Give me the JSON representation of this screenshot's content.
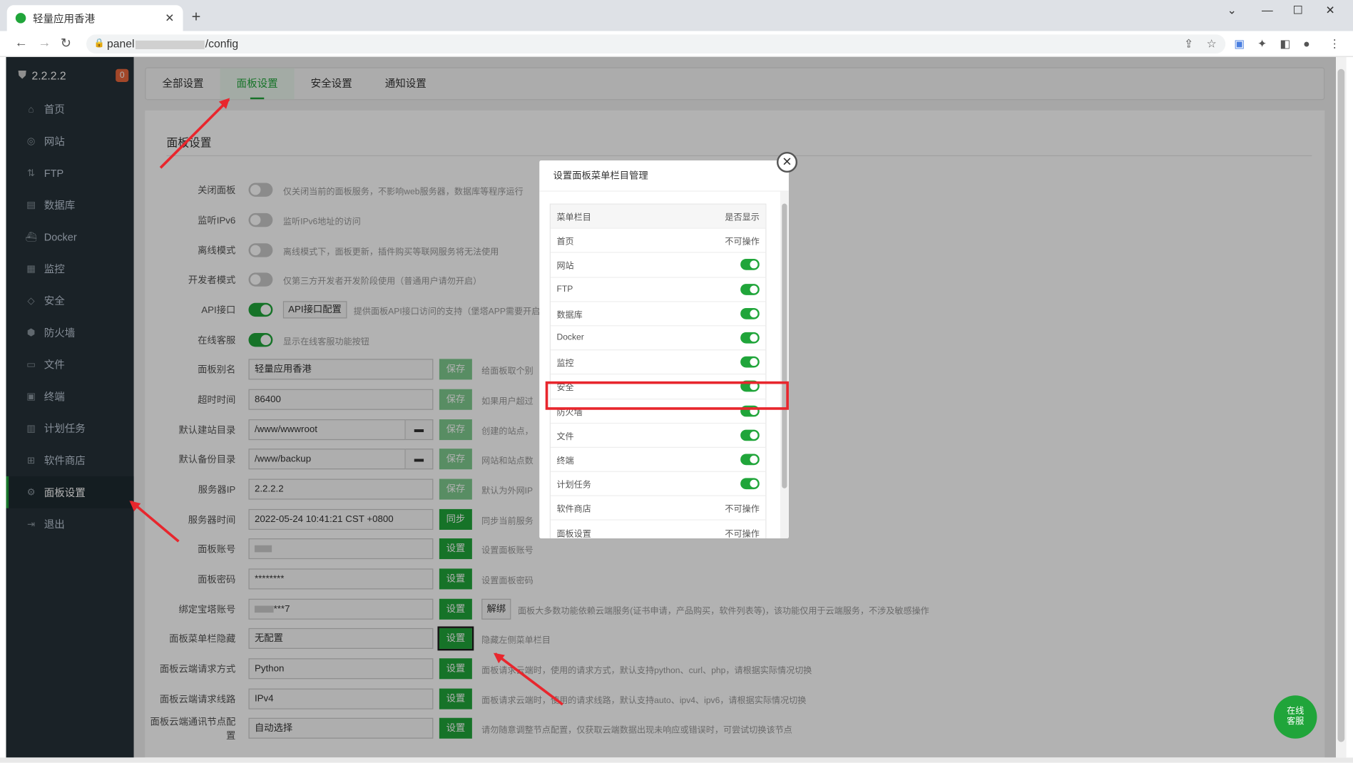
{
  "browser": {
    "tab_title": "轻量应用香港",
    "url_prefix": "panel",
    "url_suffix": "/config"
  },
  "sidebar": {
    "version": "2.2.2.2",
    "badge": "0",
    "items": [
      {
        "label": "首页",
        "icon": "home-icon"
      },
      {
        "label": "网站",
        "icon": "globe-icon"
      },
      {
        "label": "FTP",
        "icon": "ftp-icon"
      },
      {
        "label": "数据库",
        "icon": "database-icon"
      },
      {
        "label": "Docker",
        "icon": "docker-icon"
      },
      {
        "label": "监控",
        "icon": "monitor-icon"
      },
      {
        "label": "安全",
        "icon": "shield-icon"
      },
      {
        "label": "防火墙",
        "icon": "firewall-icon"
      },
      {
        "label": "文件",
        "icon": "folder-icon"
      },
      {
        "label": "终端",
        "icon": "terminal-icon"
      },
      {
        "label": "计划任务",
        "icon": "calendar-icon"
      },
      {
        "label": "软件商店",
        "icon": "apps-icon"
      },
      {
        "label": "面板设置",
        "icon": "gear-icon"
      },
      {
        "label": "退出",
        "icon": "logout-icon"
      }
    ]
  },
  "tabs": [
    "全部设置",
    "面板设置",
    "安全设置",
    "通知设置"
  ],
  "section_title": "面板设置",
  "settings": {
    "close_panel": {
      "label": "关闭面板",
      "desc": "仅关闭当前的面板服务，不影响web服务器，数据库等程序运行"
    },
    "ipv6": {
      "label": "监听IPv6",
      "desc": "监听IPv6地址的访问"
    },
    "offline": {
      "label": "离线模式",
      "desc": "离线模式下，面板更新，插件购买等联网服务将无法使用"
    },
    "dev": {
      "label": "开发者模式",
      "desc": "仅第三方开发者开发阶段使用（普通用户请勿开启）"
    },
    "api": {
      "label": "API接口",
      "button": "API接口配置",
      "desc": "提供面板API接口访问的支持（堡塔APP需要开启"
    },
    "service": {
      "label": "在线客服",
      "desc": "显示在线客服功能按钮"
    },
    "alias": {
      "label": "面板别名",
      "value": "轻量应用香港",
      "button": "保存",
      "desc": "给面板取个别"
    },
    "timeout": {
      "label": "超时时间",
      "value": "86400",
      "button": "保存",
      "desc": "如果用户超过"
    },
    "site_dir": {
      "label": "默认建站目录",
      "value": "/www/wwwroot",
      "button": "保存",
      "desc": "创建的站点，"
    },
    "backup_dir": {
      "label": "默认备份目录",
      "value": "/www/backup",
      "button": "保存",
      "desc": "网站和站点数"
    },
    "server_ip": {
      "label": "服务器IP",
      "value": "2.2.2.2",
      "button": "保存",
      "desc": "默认为外网IP"
    },
    "server_time": {
      "label": "服务器时间",
      "value": "2022-05-24 10:41:21 CST +0800",
      "button": "同步",
      "desc": "同步当前服务"
    },
    "account": {
      "label": "面板账号",
      "button": "设置",
      "desc": "设置面板账号"
    },
    "password": {
      "label": "面板密码",
      "value": "********",
      "button": "设置",
      "desc": "设置面板密码"
    },
    "bind": {
      "label": "绑定宝塔账号",
      "value_tail": "***7",
      "button": "设置",
      "button2": "解绑",
      "desc": "面板大多数功能依赖云端服务(证书申请，产品购买，软件列表等)，该功能仅用于云端服务，不涉及敏感操作"
    },
    "menu_hide": {
      "label": "面板菜单栏隐藏",
      "value": "无配置",
      "button": "设置",
      "desc": "隐藏左侧菜单栏目"
    },
    "req_mode": {
      "label": "面板云端请求方式",
      "value": "Python",
      "button": "设置",
      "desc": "面板请求云端时，使用的请求方式，默认支持python、curl、php，请根据实际情况切换"
    },
    "req_line": {
      "label": "面板云端请求线路",
      "value": "IPv4",
      "button": "设置",
      "desc": "面板请求云端时，使用的请求线路，默认支持auto、ipv4、ipv6，请根据实际情况切换"
    },
    "node": {
      "label": "面板云端通讯节点配置",
      "value": "自动选择",
      "button": "设置",
      "desc": "请勿随意调整节点配置，仅获取云端数据出现未响应或错误时，可尝试切换该节点"
    }
  },
  "modal": {
    "title": "设置面板菜单栏目管理",
    "col1": "菜单栏目",
    "col2": "是否显示",
    "rows": [
      {
        "name": "首页",
        "state": "不可操作"
      },
      {
        "name": "网站",
        "state": "on"
      },
      {
        "name": "FTP",
        "state": "on"
      },
      {
        "name": "数据库",
        "state": "on"
      },
      {
        "name": "Docker",
        "state": "on"
      },
      {
        "name": "监控",
        "state": "on"
      },
      {
        "name": "安全",
        "state": "on"
      },
      {
        "name": "防火墙",
        "state": "on"
      },
      {
        "name": "文件",
        "state": "on"
      },
      {
        "name": "终端",
        "state": "on"
      },
      {
        "name": "计划任务",
        "state": "on"
      },
      {
        "name": "软件商店",
        "state": "不可操作"
      },
      {
        "name": "面板设置",
        "state": "不可操作"
      }
    ]
  },
  "fab": {
    "line1": "在线",
    "line2": "客服"
  },
  "colors": {
    "accent": "#20a53a",
    "highlight": "#e8262d",
    "sidebar_bg": "#263238"
  }
}
